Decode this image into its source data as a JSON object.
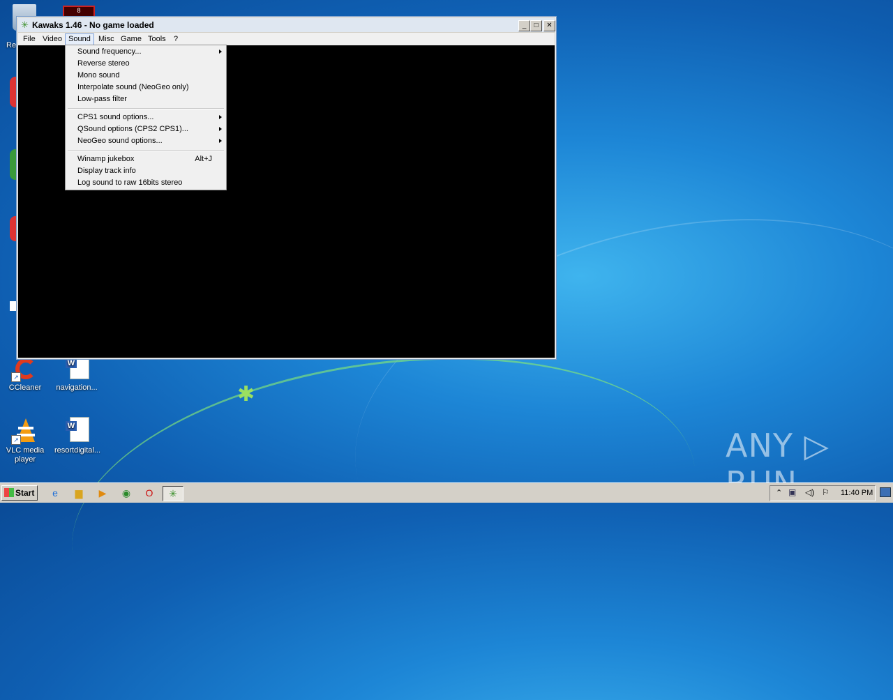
{
  "desktop": {
    "icons": [
      {
        "label": "CCleaner"
      },
      {
        "label": "navigation..."
      },
      {
        "label": "VLC media player"
      },
      {
        "label": "resortdigital..."
      }
    ],
    "recycle_bin_partial": "Re"
  },
  "window": {
    "title": "Kawaks 1.46 - No game loaded",
    "controls": {
      "minimize": "_",
      "maximize": "□",
      "close": "✕"
    },
    "menu": [
      "File",
      "Video",
      "Sound",
      "Misc",
      "Game",
      "Tools",
      "?"
    ],
    "active_menu": "Sound"
  },
  "sound_menu": {
    "items": [
      {
        "label": "Sound frequency...",
        "submenu": true
      },
      {
        "label": "Reverse stereo"
      },
      {
        "label": "Mono sound"
      },
      {
        "label": "Interpolate sound (NeoGeo only)"
      },
      {
        "label": "Low-pass filter"
      },
      {
        "label": "CPS1 sound options...",
        "submenu": true
      },
      {
        "label": "QSound options (CPS2  CPS1)...",
        "submenu": true
      },
      {
        "label": "NeoGeo sound options...",
        "submenu": true
      },
      {
        "label": "Winamp jukebox",
        "shortcut": "Alt+J"
      },
      {
        "label": "Display track info"
      },
      {
        "label": "Log sound to raw 16bits stereo"
      }
    ]
  },
  "taskbar": {
    "start_label": "Start",
    "clock": "11:40 PM"
  },
  "watermark": "ANY ▷ RUN",
  "colors": {
    "desktop": "#1d86d6",
    "client_area": "#000000",
    "menu_bg": "#f0f0f0"
  }
}
